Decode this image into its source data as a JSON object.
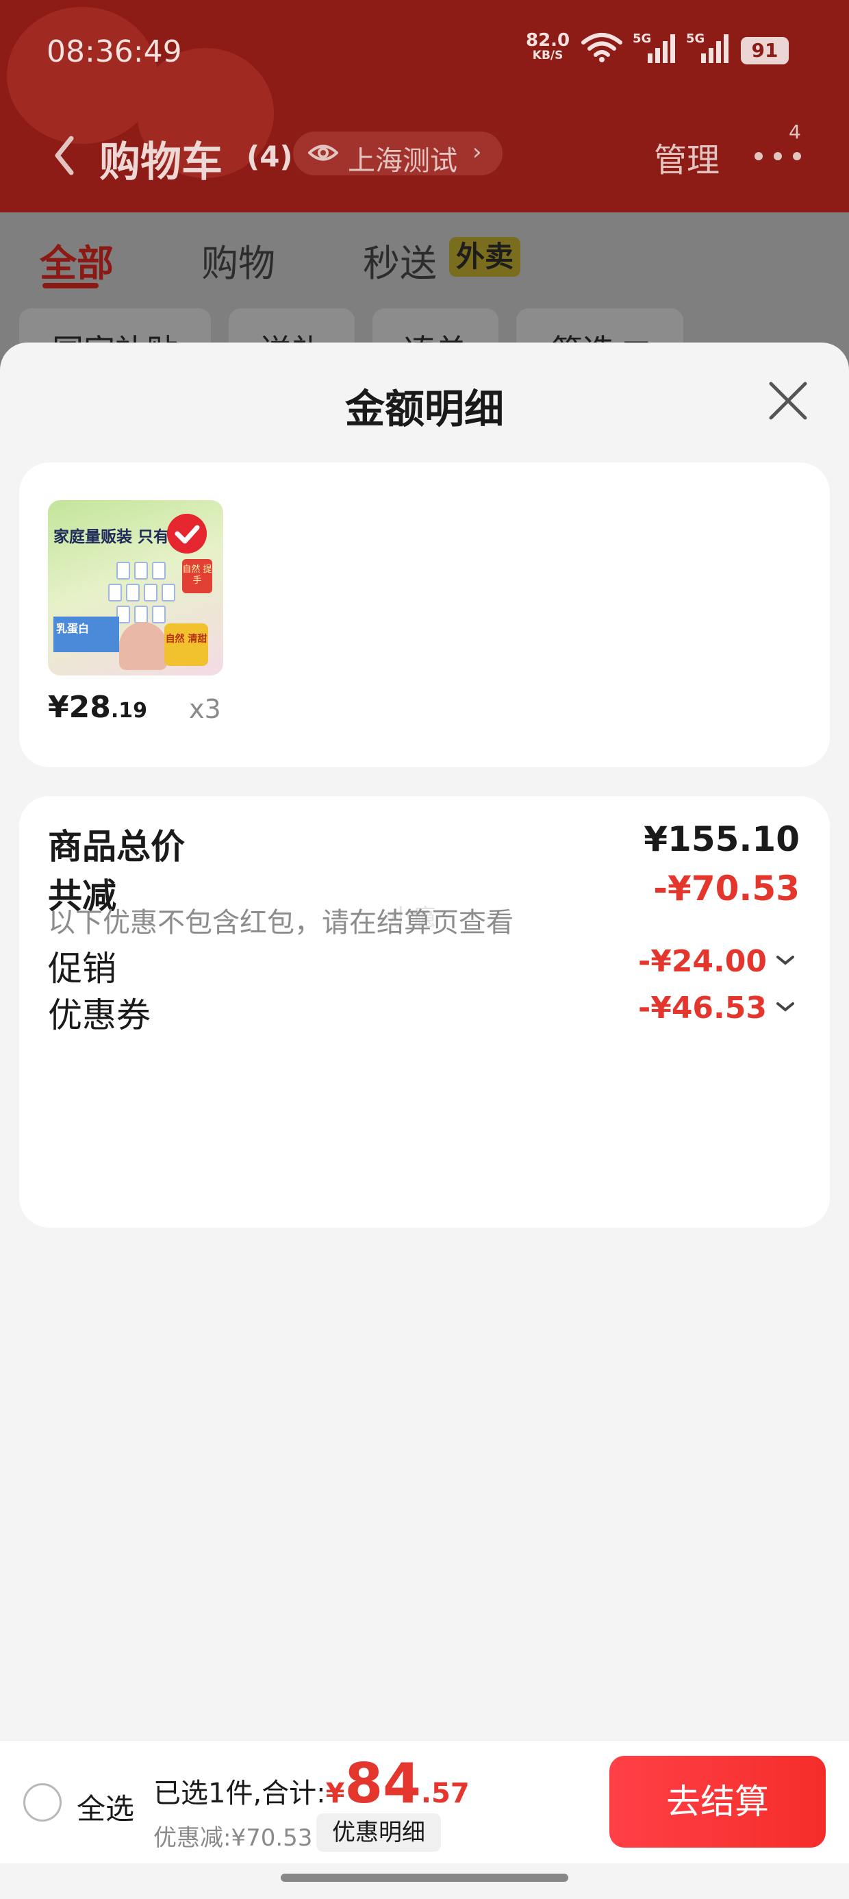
{
  "status_bar": {
    "time": "08:36:49",
    "net_speed": "82.0",
    "net_unit": "KB/S",
    "sig1_label": "5G",
    "sig2_label": "5G",
    "battery": "91"
  },
  "nav": {
    "title": "购物车",
    "count": "(4)",
    "location": "上海测试",
    "location_chevron": "›",
    "manage": "管理",
    "more_badge": "4"
  },
  "tabs": [
    {
      "label": "全部",
      "active": true
    },
    {
      "label": "购物",
      "active": false
    },
    {
      "label": "秒送",
      "active": false
    }
  ],
  "takeout_badge": "外卖",
  "filter_chips": [
    "国家补贴",
    "送礼",
    "凑单",
    "筛选 ▽"
  ],
  "sheet": {
    "title": "金额明细",
    "product": {
      "image_banner": "家庭量贩装 只有乳",
      "image_badge": "自然 提手",
      "image_blue_text": "乳蛋白",
      "image_sun_text": "自然 清甜",
      "price_int": "¥28",
      "price_dec": ".19",
      "qty": "x3"
    },
    "watermark": "小瘾",
    "total_label": "商品总价",
    "total_value": "¥155.10",
    "reduce_label": "共减",
    "reduce_value": "-¥70.53",
    "note": "以下优惠不包含红包，请在结算页查看",
    "promo_label": "促销",
    "promo_value": "-¥24.00",
    "coupon_label": "优惠券",
    "coupon_value": "-¥46.53"
  },
  "bottom_bar": {
    "select_all": "全选",
    "summary_label": "已选1件,合计:",
    "yen": "¥",
    "total_int": "84",
    "total_dec": ".57",
    "discount": "优惠减:¥70.53",
    "detail_button": "优惠明细",
    "checkout": "去结算"
  },
  "colors": {
    "accent_red": "#e4362d",
    "header_red_dimmed": "#8e1c16",
    "checkout_red": "#f52d2a"
  }
}
